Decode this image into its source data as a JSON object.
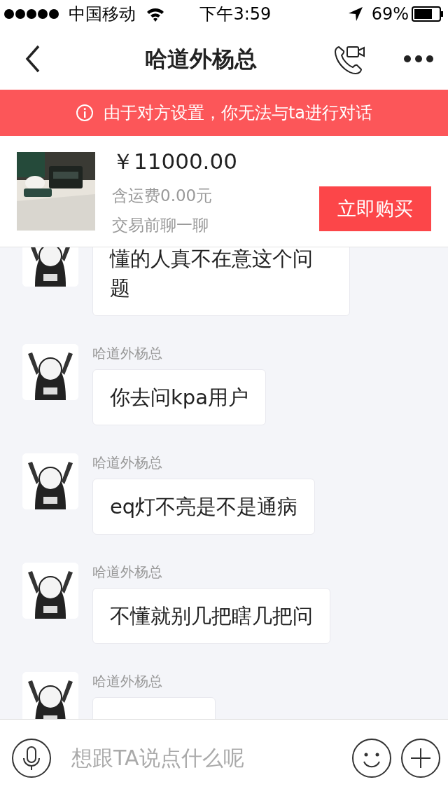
{
  "status_bar": {
    "carrier": "中国移动",
    "time": "下午3:59",
    "battery": "69%"
  },
  "nav": {
    "title": "哈道外杨总"
  },
  "notice": {
    "text": "由于对方设置，你无法与ta进行对话"
  },
  "product": {
    "kind": "picture",
    "price": "￥11000.00",
    "shipping": "含运费0.00元",
    "note": "交易前聊一聊",
    "buy_button": "立即购买"
  },
  "messages": [
    {
      "text": "懂的人真不在意这个问题"
    },
    {
      "sender": "哈道外杨总",
      "text": "你去问kpa用户"
    },
    {
      "sender": "哈道外杨总",
      "text": "eq灯不亮是不是通病"
    },
    {
      "sender": "哈道外杨总",
      "text": "不懂就别几把瞎几把问"
    },
    {
      "sender": "哈道外杨总"
    }
  ],
  "input": {
    "placeholder": "想跟TA说点什么呢"
  }
}
